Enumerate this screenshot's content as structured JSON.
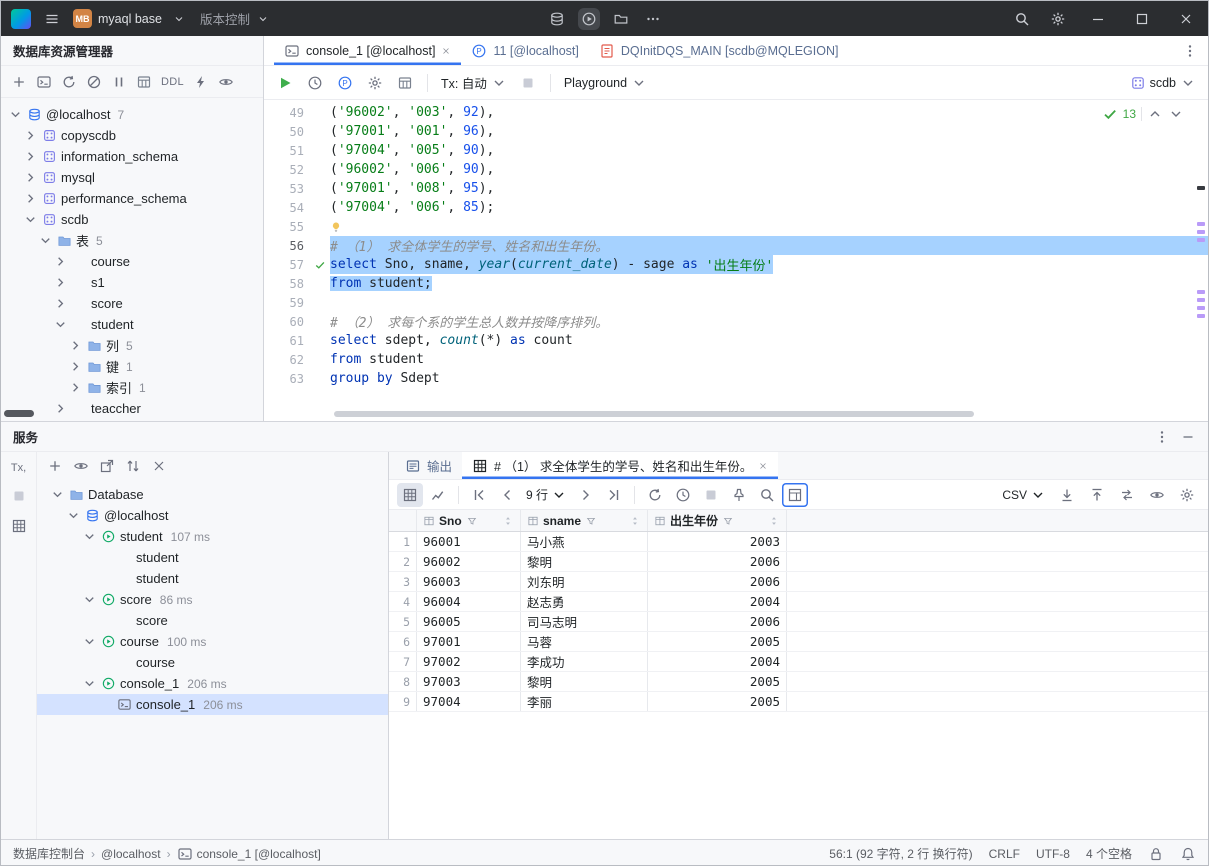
{
  "colors": {
    "accent": "#3574f0",
    "selection": "#a6d2ff",
    "string": "#067d17",
    "keyword": "#0033b3",
    "number": "#1750eb",
    "comment": "#8c8c8c",
    "success": "#3fa744"
  },
  "titlebar": {
    "project_badge": "MB",
    "project_name": "myaql base",
    "vcs_label": "版本控制"
  },
  "explorer": {
    "title": "数据库资源管理器",
    "ddl_label": "DDL",
    "tree": [
      {
        "label": "@localhost",
        "count": "7",
        "level": 0,
        "chev": "open",
        "icon": "db"
      },
      {
        "label": "copyscdb",
        "level": 1,
        "chev": "closed",
        "icon": "schema"
      },
      {
        "label": "information_schema",
        "level": 1,
        "chev": "closed",
        "icon": "schema"
      },
      {
        "label": "mysql",
        "level": 1,
        "chev": "closed",
        "icon": "schema"
      },
      {
        "label": "performance_schema",
        "level": 1,
        "chev": "closed",
        "icon": "schema"
      },
      {
        "label": "scdb",
        "level": 1,
        "chev": "open",
        "icon": "schema"
      },
      {
        "label": "表",
        "count": "5",
        "level": 2,
        "chev": "open",
        "icon": "folder"
      },
      {
        "label": "course",
        "level": 3,
        "chev": "closed",
        "icon": "table"
      },
      {
        "label": "s1",
        "level": 3,
        "chev": "closed",
        "icon": "table"
      },
      {
        "label": "score",
        "level": 3,
        "chev": "closed",
        "icon": "table"
      },
      {
        "label": "student",
        "level": 3,
        "chev": "open",
        "icon": "table"
      },
      {
        "label": "列",
        "count": "5",
        "level": 4,
        "chev": "closed",
        "icon": "folder"
      },
      {
        "label": "键",
        "count": "1",
        "level": 4,
        "chev": "closed",
        "icon": "folder"
      },
      {
        "label": "索引",
        "count": "1",
        "level": 4,
        "chev": "closed",
        "icon": "folder"
      },
      {
        "label": "teaccher",
        "level": 3,
        "chev": "closed",
        "icon": "table"
      }
    ]
  },
  "editor": {
    "tabs": [
      {
        "label": "console_1 [@localhost]",
        "icon": "console",
        "active": true,
        "closable": true
      },
      {
        "label": "11 [@localhost]",
        "icon": "pcirc"
      },
      {
        "label": "DQInitDQS_MAIN [scdb@MQLEGION]",
        "icon": "filered"
      }
    ],
    "toolbar": {
      "tx": "Tx: 自动",
      "playground": "Playground",
      "schema": "scdb"
    },
    "success_count": "13",
    "lines": [
      {
        "n": "49",
        "seg": [
          [
            "(",
            "p"
          ],
          [
            "'96002'",
            "s"
          ],
          [
            ", ",
            "p"
          ],
          [
            "'003'",
            "s"
          ],
          [
            ", ",
            "p"
          ],
          [
            "92",
            "n"
          ],
          [
            "),",
            "p"
          ]
        ]
      },
      {
        "n": "50",
        "seg": [
          [
            "(",
            "p"
          ],
          [
            "'97001'",
            "s"
          ],
          [
            ", ",
            "p"
          ],
          [
            "'001'",
            "s"
          ],
          [
            ", ",
            "p"
          ],
          [
            "96",
            "n"
          ],
          [
            "),",
            "p"
          ]
        ]
      },
      {
        "n": "51",
        "seg": [
          [
            "(",
            "p"
          ],
          [
            "'97004'",
            "s"
          ],
          [
            ", ",
            "p"
          ],
          [
            "'005'",
            "s"
          ],
          [
            ", ",
            "p"
          ],
          [
            "90",
            "n"
          ],
          [
            "),",
            "p"
          ]
        ]
      },
      {
        "n": "52",
        "seg": [
          [
            "(",
            "p"
          ],
          [
            "'96002'",
            "s"
          ],
          [
            ", ",
            "p"
          ],
          [
            "'006'",
            "s"
          ],
          [
            ", ",
            "p"
          ],
          [
            "90",
            "n"
          ],
          [
            "),",
            "p"
          ]
        ]
      },
      {
        "n": "53",
        "seg": [
          [
            "(",
            "p"
          ],
          [
            "'97001'",
            "s"
          ],
          [
            ", ",
            "p"
          ],
          [
            "'008'",
            "s"
          ],
          [
            ", ",
            "p"
          ],
          [
            "95",
            "n"
          ],
          [
            "),",
            "p"
          ]
        ]
      },
      {
        "n": "54",
        "seg": [
          [
            "(",
            "p"
          ],
          [
            "'97004'",
            "s"
          ],
          [
            ", ",
            "p"
          ],
          [
            "'006'",
            "s"
          ],
          [
            ", ",
            "p"
          ],
          [
            "85",
            "n"
          ],
          [
            ");",
            "p"
          ]
        ]
      },
      {
        "n": "55",
        "seg": [],
        "bulb": true
      },
      {
        "n": "56",
        "seg": [
          [
            "# （1） 求全体学生的学号、姓名和出生年份。",
            "c"
          ]
        ],
        "sel": "full",
        "cur": true
      },
      {
        "n": "57",
        "seg": [
          [
            "select",
            "k"
          ],
          [
            " Sno, sname, ",
            "p"
          ],
          [
            "year",
            "f"
          ],
          [
            "(",
            "p"
          ],
          [
            "current_date",
            "f"
          ],
          [
            ") - sage ",
            "p"
          ],
          [
            "as",
            "k"
          ],
          [
            " ",
            "p"
          ],
          [
            "'出生年份'",
            "s"
          ]
        ],
        "sel": "text",
        "check": true
      },
      {
        "n": "58",
        "seg": [
          [
            "from",
            "k"
          ],
          [
            " student;",
            "p"
          ]
        ],
        "sel": "text"
      },
      {
        "n": "59",
        "seg": []
      },
      {
        "n": "60",
        "seg": [
          [
            "# （2） 求每个系的学生总人数并按降序排列。",
            "c"
          ]
        ]
      },
      {
        "n": "61",
        "seg": [
          [
            "select",
            "k"
          ],
          [
            " sdept, ",
            "p"
          ],
          [
            "count",
            "f"
          ],
          [
            "(*) ",
            "p"
          ],
          [
            "as",
            "k"
          ],
          [
            " count",
            "p"
          ]
        ]
      },
      {
        "n": "62",
        "seg": [
          [
            "from",
            "k"
          ],
          [
            " student",
            "p"
          ]
        ]
      },
      {
        "n": "63",
        "seg": [
          [
            "group by",
            "k"
          ],
          [
            " Sdept",
            "p"
          ]
        ]
      }
    ]
  },
  "services": {
    "title": "服务",
    "tree": [
      {
        "label": "Database",
        "level": 0,
        "chev": "open",
        "icon": "folder"
      },
      {
        "label": "@localhost",
        "level": 1,
        "chev": "open",
        "icon": "db"
      },
      {
        "label": "student",
        "time": "107 ms",
        "level": 2,
        "chev": "open",
        "icon": "query"
      },
      {
        "label": "student",
        "level": 3,
        "icon": "table"
      },
      {
        "label": "student",
        "level": 3,
        "icon": "table"
      },
      {
        "label": "score",
        "time": "86 ms",
        "level": 2,
        "chev": "open",
        "icon": "query"
      },
      {
        "label": "score",
        "level": 3,
        "icon": "table"
      },
      {
        "label": "course",
        "time": "100 ms",
        "level": 2,
        "chev": "open",
        "icon": "query"
      },
      {
        "label": "course",
        "level": 3,
        "icon": "table"
      },
      {
        "label": "console_1",
        "time": "206 ms",
        "level": 2,
        "chev": "open",
        "icon": "query"
      },
      {
        "label": "console_1",
        "time": "206 ms",
        "level": 3,
        "icon": "console",
        "selected": true
      }
    ],
    "result_tabs": [
      {
        "label": "输出",
        "icon": "outlist"
      },
      {
        "label": "# （1） 求全体学生的学号、姓名和出生年份。",
        "icon": "grid",
        "active": true,
        "closable": true
      }
    ],
    "toolbar": {
      "rows": "9 行",
      "csv": "CSV"
    },
    "table": {
      "columns": [
        {
          "name": "Sno"
        },
        {
          "name": "sname"
        },
        {
          "name": "出生年份",
          "numeric": true
        }
      ],
      "rows": [
        [
          "96001",
          "马小燕",
          "2003"
        ],
        [
          "96002",
          "黎明",
          "2006"
        ],
        [
          "96003",
          "刘东明",
          "2006"
        ],
        [
          "96004",
          "赵志勇",
          "2004"
        ],
        [
          "96005",
          "司马志明",
          "2006"
        ],
        [
          "97001",
          "马蓉",
          "2005"
        ],
        [
          "97002",
          "李成功",
          "2004"
        ],
        [
          "97003",
          "黎明",
          "2005"
        ],
        [
          "97004",
          "李丽",
          "2005"
        ]
      ]
    }
  },
  "statusbar": {
    "breadcrumb": [
      "数据库控制台",
      "@localhost",
      "console_1 [@localhost]"
    ],
    "caret": "56:1 (92 字符, 2 行 换行符)",
    "line_sep": "CRLF",
    "encoding": "UTF-8",
    "indent": "4 个空格"
  }
}
